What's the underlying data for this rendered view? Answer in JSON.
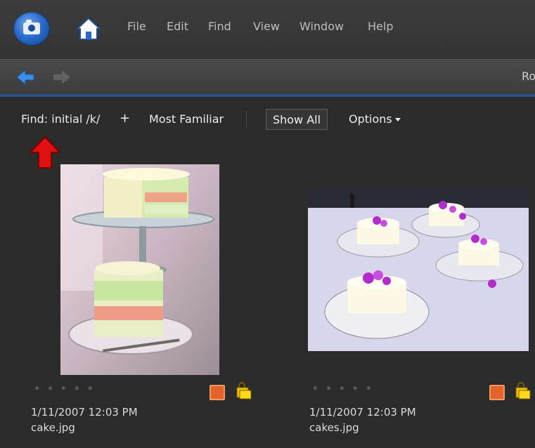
{
  "menu": {
    "items": [
      "File",
      "Edit",
      "Find",
      "View",
      "Window",
      "Help"
    ]
  },
  "toolbar": {
    "right_cut_text": "Ro"
  },
  "findbar": {
    "find_label": "Find: initial /k/",
    "add": "+",
    "most_familiar": "Most Familiar",
    "show_all": "Show All",
    "options": "Options"
  },
  "photos": [
    {
      "date": "1/11/2007 12:03 PM",
      "filename": "cake.jpg",
      "rating_stars": 0
    },
    {
      "date": "1/11/2007 12:03 PM",
      "filename": "cakes.jpg",
      "rating_stars": 0
    }
  ],
  "colors": {
    "accent_bar": "#2d4f84",
    "tag_orange": "#e2632b",
    "arrow_red": "#e0100f"
  },
  "icons": {
    "logo": "camera-logo-icon",
    "home": "home-icon",
    "back": "back-arrow-icon",
    "forward": "forward-arrow-icon",
    "annotation": "red-up-arrow-icon",
    "tag": "tag-icon",
    "stack": "lock-icon"
  }
}
